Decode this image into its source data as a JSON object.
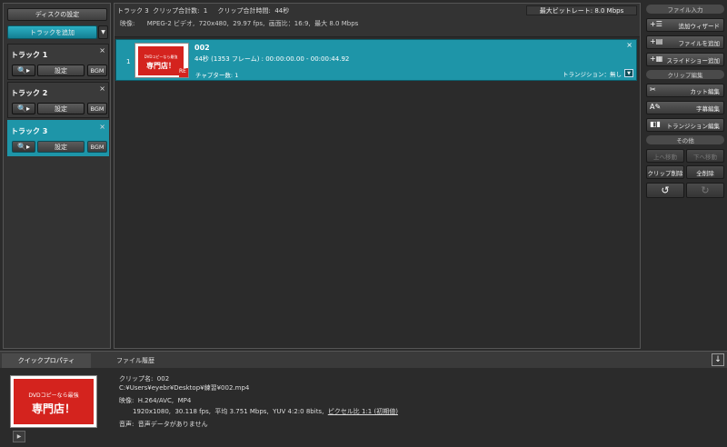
{
  "left": {
    "disc_settings": "ディスクの設定",
    "add_track": "トラックを追加",
    "tracks": [
      {
        "name": "トラック 1",
        "settings": "設定",
        "bgm": "BGM",
        "close": "×"
      },
      {
        "name": "トラック 2",
        "settings": "設定",
        "bgm": "BGM",
        "close": "×"
      },
      {
        "name": "トラック 3",
        "settings": "設定",
        "bgm": "BGM",
        "close": "×"
      }
    ]
  },
  "center": {
    "track_info": "トラック 3  クリップ合計数:  1     クリップ合計時間:  44秒",
    "max_bitrate": "最大ビットレート: 8.0 Mbps",
    "video_label": "映像:",
    "video_info": "MPEG-2 ビデオ,  720x480,  29.97 fps,  画面比：16:9,  最大 8.0 Mbps",
    "clip": {
      "index": "1",
      "name": "002",
      "duration": "44秒 (1353 フレーム) :  00:00:00.00 - 00:00:44.92",
      "chapters": "チャプター数: 1",
      "transition": "トランジション：無し",
      "close": "×",
      "thumb_line1": "DVDコピーなら最強",
      "thumb_line2": "専門店！",
      "thumb_badge": "RE"
    }
  },
  "right": {
    "file_input": "ファイル入力",
    "import_wizard": "追加ウィザード",
    "add_file": "ファイルを追加",
    "add_slideshow": "スライドショー追加",
    "clip_edit": "クリップ編集",
    "cut_edit": "カット編集",
    "subtitle_edit": "字幕編集",
    "transition_edit": "トランジション編集",
    "other": "その他",
    "move_up": "上へ移動",
    "move_down": "下へ移動",
    "delete_clip": "クリップ削除",
    "delete_all": "全削除"
  },
  "bottom": {
    "tab_quick": "クイックプロパティ",
    "tab_history": "ファイル履歴",
    "clip_name": "クリップ名:  002",
    "path": "C:¥Users¥eyebr¥Desktop¥練習¥002.mp4",
    "video_line1": "映像:  H.264/AVC,  MP4",
    "video_line2_pre": "1920x1080,  30.118 fps,  平均 3.751 Mbps,  YUV 4:2:0 8bits,  ",
    "video_line2_link": "ピクセル比 1:1 (初期値)",
    "audio": "音声:  音声データがありません",
    "thumb_line1": "DVDコピーなら最強",
    "thumb_line2": "専門店！"
  }
}
